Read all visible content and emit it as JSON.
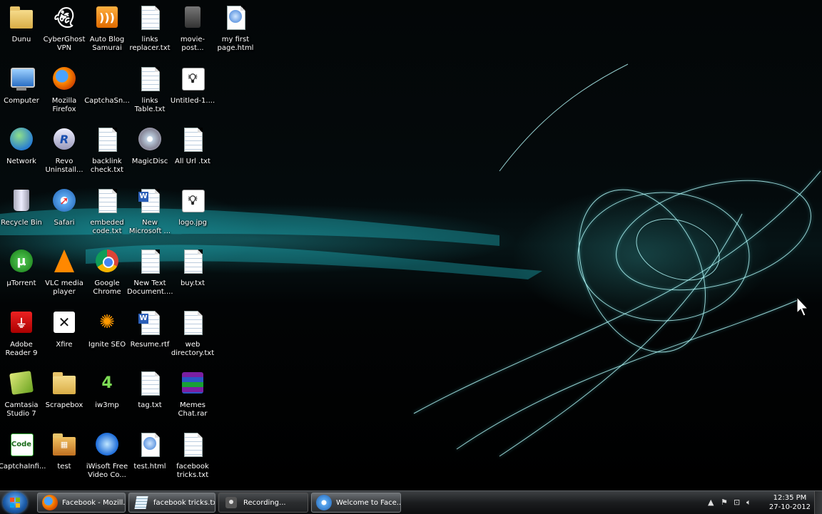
{
  "desktop": {
    "icons": [
      {
        "label": "Dunu",
        "icon": "folder-icon"
      },
      {
        "label": "CyberGhost\nVPN",
        "icon": "ghost-icon"
      },
      {
        "label": "Auto Blog\nSamurai",
        "icon": "rss-icon"
      },
      {
        "label": "links\nreplacer.txt",
        "icon": "text-file-icon"
      },
      {
        "label": "movie-post...",
        "icon": "image-file-icon"
      },
      {
        "label": "my first\npage.html",
        "icon": "html-file-icon"
      },
      {
        "label": "Computer",
        "icon": "computer-icon"
      },
      {
        "label": "Mozilla\nFirefox",
        "icon": "firefox-icon"
      },
      {
        "label": "CaptchaSn...",
        "icon": "blank-icon"
      },
      {
        "label": "links\nTable.txt",
        "icon": "text-file-icon"
      },
      {
        "label": "Untitled-1....",
        "icon": "bulb-image-icon"
      },
      {
        "label": "Network",
        "icon": "network-icon"
      },
      {
        "label": "Revo\nUninstall...",
        "icon": "revo-icon"
      },
      {
        "label": "backlink\ncheck.txt",
        "icon": "text-file-icon"
      },
      {
        "label": "MagicDisc",
        "icon": "disc-icon"
      },
      {
        "label": "All Url .txt",
        "icon": "text-file-icon"
      },
      {
        "label": "Recycle Bin",
        "icon": "recycle-bin-icon"
      },
      {
        "label": "Safari",
        "icon": "safari-icon"
      },
      {
        "label": "embeded\ncode.txt",
        "icon": "text-file-icon"
      },
      {
        "label": "New\nMicrosoft ...",
        "icon": "word-doc-icon"
      },
      {
        "label": "logo.jpg",
        "icon": "bulb-image-icon"
      },
      {
        "label": "µTorrent",
        "icon": "utorrent-icon"
      },
      {
        "label": "VLC media\nplayer",
        "icon": "vlc-icon"
      },
      {
        "label": "Google\nChrome",
        "icon": "chrome-icon"
      },
      {
        "label": "New Text\nDocument....",
        "icon": "text-file-icon"
      },
      {
        "label": "buy.txt",
        "icon": "text-file-icon"
      },
      {
        "label": "Adobe\nReader 9",
        "icon": "adobe-reader-icon"
      },
      {
        "label": "Xfire",
        "icon": "xfire-icon"
      },
      {
        "label": "Ignite SEO",
        "icon": "ignite-seo-icon"
      },
      {
        "label": "Resume.rtf",
        "icon": "word-doc-icon"
      },
      {
        "label": "web\ndirectory.txt",
        "icon": "text-file-icon"
      },
      {
        "label": "Camtasia\nStudio 7",
        "icon": "camtasia-icon"
      },
      {
        "label": "Scrapebox",
        "icon": "folder-icon"
      },
      {
        "label": "iw3mp",
        "icon": "cod4-icon"
      },
      {
        "label": "tag.txt",
        "icon": "text-file-icon"
      },
      {
        "label": "Memes\nChat.rar",
        "icon": "winrar-icon"
      },
      {
        "label": "CaptchaInfi...",
        "icon": "code-icon"
      },
      {
        "label": "test",
        "icon": "test-folder-icon"
      },
      {
        "label": "iWisoft Free\nVideo Co...",
        "icon": "iwisoft-icon"
      },
      {
        "label": "test.html",
        "icon": "html-file-icon"
      },
      {
        "label": "facebook\ntricks.txt",
        "icon": "text-file-icon"
      }
    ]
  },
  "taskbar": {
    "start_label": "Start",
    "tasks": [
      {
        "label": "Facebook - Mozill...",
        "icon": "firefox-icon",
        "active": true
      },
      {
        "label": "facebook tricks.tx...",
        "icon": "notepad-icon",
        "active": true
      },
      {
        "label": "Recording...",
        "icon": "camtasia-recorder-icon",
        "active": false
      },
      {
        "label": "Welcome to Face...",
        "icon": "safari-icon",
        "active": true
      }
    ],
    "clock": {
      "time": "12:35 PM",
      "date": "27-10-2012"
    }
  },
  "colors": {
    "accent": "#2ee6f0",
    "taskbar": "#1b1d1f"
  }
}
